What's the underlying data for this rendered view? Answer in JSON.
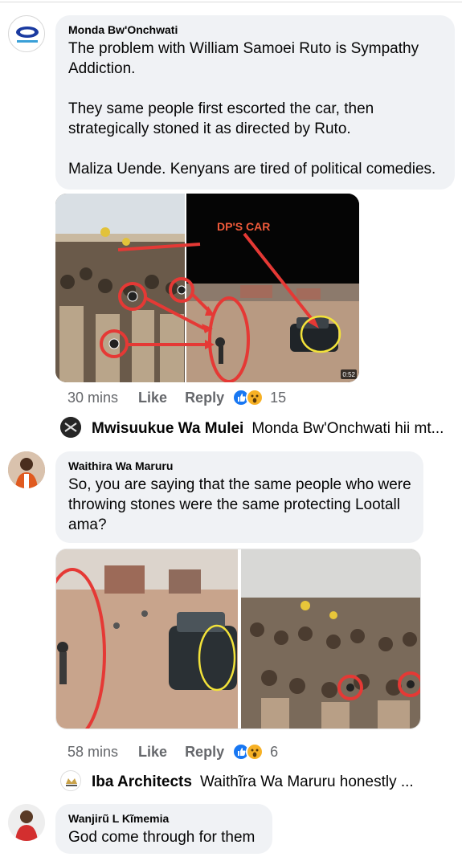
{
  "comments": [
    {
      "author": "Monda Bw'Onchwati",
      "text": "The problem with William Samoei Ruto is Sympathy Addiction.\n\nThey same people first escorted the car, then strategically stoned it as directed by Ruto.\n\nMaliza Uende. Kenyans are tired of political comedies.",
      "photo": {
        "overlay_label": "DP'S CAR",
        "duration": "0:52"
      },
      "time": "30 mins",
      "like_label": "Like",
      "reply_label": "Reply",
      "reactions": [
        "like",
        "wow"
      ],
      "reaction_count": "15",
      "reply_preview": {
        "author": "Mwisuukue Wa Mulei",
        "text": "Monda Bw'Onchwati hii mt..."
      }
    },
    {
      "author": "Waithira Wa Maruru",
      "text": "So, you are saying that the same people who were throwing stones were the same protecting Lootall ama?",
      "time": "58 mins",
      "like_label": "Like",
      "reply_label": "Reply",
      "reactions": [
        "like",
        "wow"
      ],
      "reaction_count": "6",
      "reply_preview": {
        "author": "Iba Architects",
        "text": "Waithĩra Wa Maruru honestly ..."
      }
    },
    {
      "author": "Wanjirũ L Kĩmemia",
      "text": "God come through for them"
    }
  ],
  "colors": {
    "bubble": "#f0f2f5",
    "meta": "#65676b",
    "like_blue": "#1877f2",
    "wow_yellow": "#f7b125",
    "annotation_red": "#e53935"
  }
}
